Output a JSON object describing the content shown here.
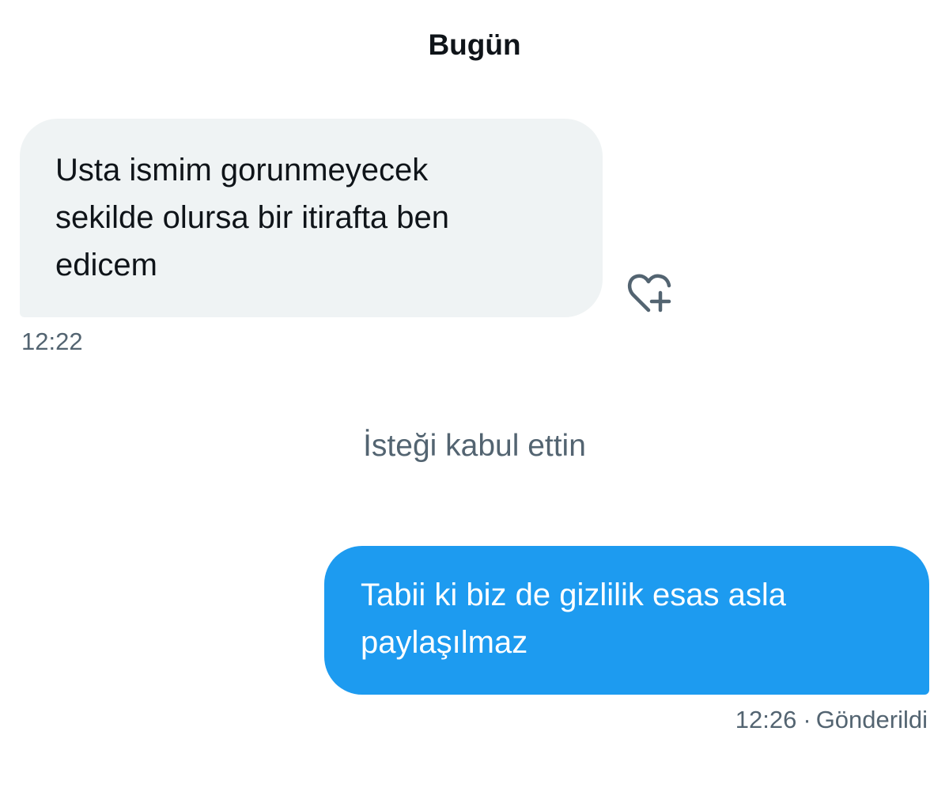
{
  "conversation": {
    "date_header": "Bugün",
    "messages": [
      {
        "direction": "incoming",
        "lines": [
          "Usta ismim gorunmeyecek",
          "sekilde olursa bir itirafta ben",
          "edicem"
        ],
        "time": "12:22",
        "reaction_icon": "heart-plus-icon"
      },
      {
        "direction": "outgoing",
        "lines": [
          "Tabii ki biz de gizlilik esas asla",
          "paylaşılmaz"
        ],
        "time": "12:26",
        "separator": "·",
        "status": "Gönderildi"
      }
    ],
    "system_note": "İsteği kabul ettin"
  },
  "colors": {
    "incoming_bubble": "#eff3f4",
    "outgoing_bubble": "#1d9bf0",
    "secondary_text": "#536471",
    "primary_text": "#0f1419"
  }
}
